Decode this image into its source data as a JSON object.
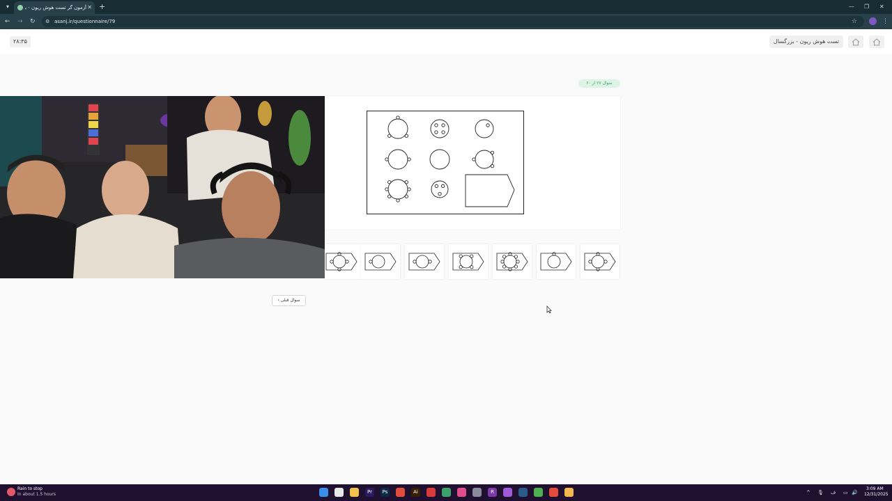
{
  "browser": {
    "tab_title": "آزمون گر تست هوش ریون - بزرگ",
    "tab_close": "✕",
    "new_tab": "+",
    "url": "asanj.ir/questionnaire/79",
    "window_controls": [
      "—",
      "❐",
      "✕"
    ]
  },
  "header": {
    "timer": "۲۸:۳۵",
    "title": "تست هوش ریون - بزرگسال"
  },
  "question": {
    "counter": "سوال ۲۷ از ۶۰",
    "prev_button": "سوال قبلی ›"
  },
  "matrix": {
    "rows": [
      [
        {
          "circle": "large",
          "dots": [
            "top",
            "bottom-left",
            "bottom-right"
          ]
        },
        {
          "circle": "medium",
          "dots": [
            "upper-left",
            "upper-right",
            "lower-left",
            "lower-right"
          ],
          "inside": true
        },
        {
          "circle": "medium",
          "dots": [
            "upper-right"
          ],
          "inside": true
        }
      ],
      [
        {
          "circle": "large",
          "dots": [
            "left",
            "right"
          ]
        },
        {
          "circle": "large",
          "dots": []
        },
        {
          "circle": "medium",
          "dots": [
            "top-right",
            "left",
            "bottom-right"
          ]
        }
      ],
      [
        {
          "circle": "large",
          "dots": [
            "top-left",
            "top-right",
            "left",
            "right",
            "bottom-left",
            "bottom-right",
            "bottom"
          ]
        },
        {
          "circle": "small",
          "dots": [
            "upper-left",
            "upper-right",
            "bottom"
          ],
          "inside": true
        },
        {
          "missing": true
        }
      ]
    ]
  },
  "options": [
    {
      "dots": [
        "top",
        "left",
        "right",
        "bottom"
      ]
    },
    {
      "dots": [
        "left"
      ]
    },
    {
      "dots": [
        "left",
        "right"
      ]
    },
    {
      "dots": [
        "upper-left",
        "upper-right",
        "lower-left",
        "lower-right"
      ]
    },
    {
      "dots": [
        "top",
        "top-left",
        "top-right",
        "left",
        "right",
        "bottom-left",
        "bottom-right",
        "bottom"
      ]
    },
    {
      "dots": [
        "top"
      ]
    },
    {
      "dots": [
        "top",
        "left",
        "right",
        "bottom"
      ]
    }
  ],
  "taskbar": {
    "weather_title": "Rain to stop",
    "weather_sub": "In about 1.5 hours",
    "time": "3:09 AM",
    "date": "12/31/2025",
    "lang": "ف",
    "apps": [
      {
        "icon": "start-icon",
        "label": "",
        "color": "#3b8ee8"
      },
      {
        "icon": "file-icon",
        "label": "",
        "color": "#e8e8e8"
      },
      {
        "icon": "folder-icon",
        "label": "",
        "color": "#f2c14e"
      },
      {
        "icon": "premiere-icon",
        "label": "Pr",
        "color": "#2a1a5e"
      },
      {
        "icon": "photoshop-icon",
        "label": "Ps",
        "color": "#0b2a4a"
      },
      {
        "icon": "chrome-icon",
        "label": "",
        "color": "#e34b3c"
      },
      {
        "icon": "illustrator-icon",
        "label": "Ai",
        "color": "#3a1e00"
      },
      {
        "icon": "app-red-icon",
        "label": "",
        "color": "#d93a3a"
      },
      {
        "icon": "app-green-icon",
        "label": "",
        "color": "#3aa36a"
      },
      {
        "icon": "app-pink-icon",
        "label": "",
        "color": "#e04d8a"
      },
      {
        "icon": "gear-icon",
        "label": "",
        "color": "#8a8a9a"
      },
      {
        "icon": "app-r-icon",
        "label": "R",
        "color": "#7b3aa8"
      },
      {
        "icon": "app-purple-icon",
        "label": "",
        "color": "#a05ad8"
      },
      {
        "icon": "steam-icon",
        "label": "",
        "color": "#2a5a8a"
      },
      {
        "icon": "chrome-icon",
        "label": "",
        "color": "#4caf50"
      },
      {
        "icon": "chrome-icon",
        "label": "",
        "color": "#e34b3c"
      },
      {
        "icon": "chrome-icon",
        "label": "",
        "color": "#f2b84e"
      }
    ]
  }
}
